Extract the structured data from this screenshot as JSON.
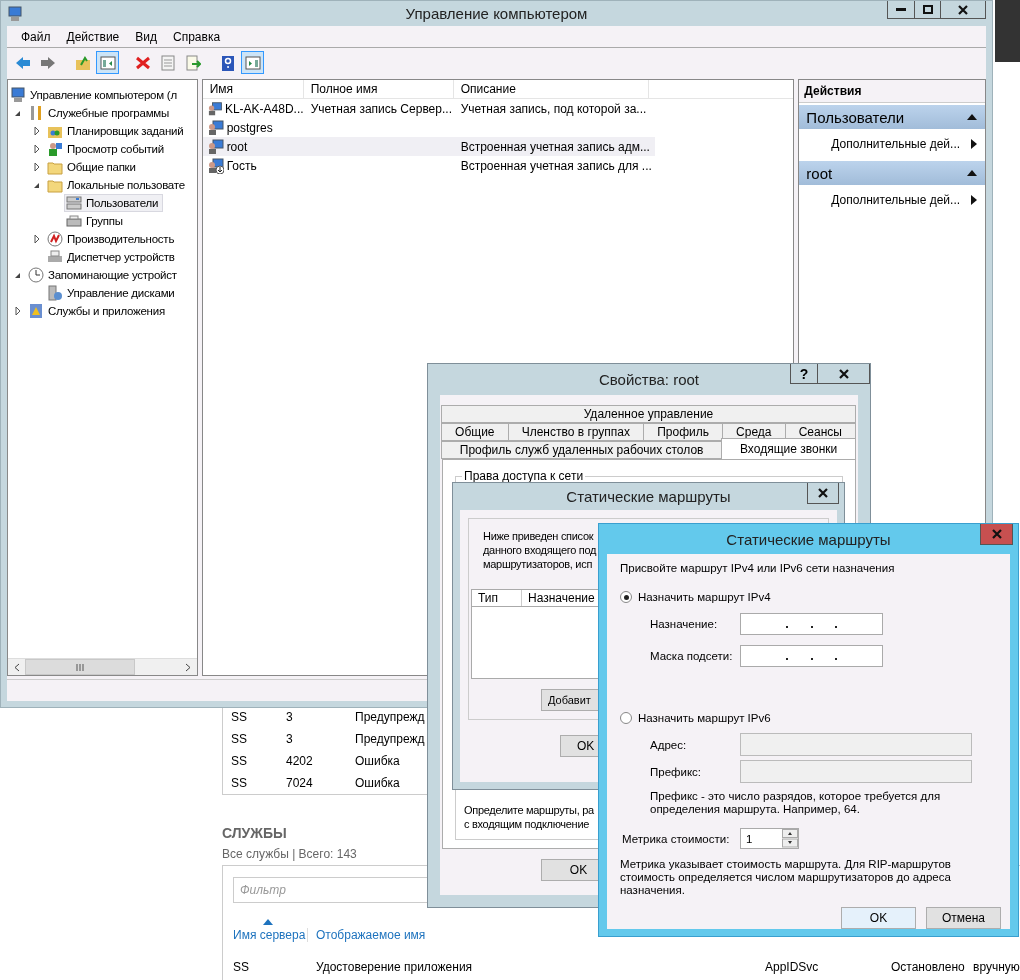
{
  "background": {
    "events": [
      {
        "server": "SS",
        "id": "3",
        "severity": "Предупрежд"
      },
      {
        "server": "SS",
        "id": "3",
        "severity": "Предупрежд"
      },
      {
        "server": "SS",
        "id": "4202",
        "severity": "Ошибка"
      },
      {
        "server": "SS",
        "id": "7024",
        "severity": "Ошибка"
      }
    ],
    "services": {
      "title": "СЛУЖБЫ",
      "subtitle": "Все службы | Всего: 143",
      "filter_placeholder": "Фильтр",
      "columns": [
        {
          "label": "Имя сервера",
          "sorted": true
        },
        {
          "label": "Отображаемое имя",
          "sorted": false
        }
      ],
      "rows": [
        {
          "server": "SS",
          "display_name": "Удостоверение приложения",
          "service_name": "AppIDSvc",
          "status": "Остановлено",
          "start_type": "вручную"
        }
      ]
    }
  },
  "main_window": {
    "title": "Управление компьютером",
    "menu": [
      "Файл",
      "Действие",
      "Вид",
      "Справка"
    ],
    "toolbar": [
      {
        "pressed": false
      },
      {
        "pressed": false
      },
      {
        "pressed": false
      },
      {
        "pressed": true
      },
      {
        "pressed": false
      },
      {
        "pressed": false
      },
      {
        "pressed": false
      },
      {
        "pressed": false
      },
      {
        "pressed": true
      }
    ],
    "tree": [
      {
        "label": "Управление компьютером (л",
        "selected": false,
        "children": [
          {
            "label": "Служебные программы",
            "selected": false,
            "expanded": true,
            "children": [
              {
                "label": "Планировщик заданий",
                "selected": false,
                "expanded": false
              },
              {
                "label": "Просмотр событий",
                "selected": false,
                "expanded": false
              },
              {
                "label": "Общие папки",
                "selected": false,
                "expanded": false
              },
              {
                "label": "Локальные пользовате",
                "selected": false,
                "expanded": true,
                "children": [
                  {
                    "label": "Пользователи",
                    "selected": true
                  },
                  {
                    "label": "Группы",
                    "selected": false
                  }
                ]
              },
              {
                "label": "Производительность",
                "selected": false,
                "expanded": false
              },
              {
                "label": "Диспетчер устройств",
                "selected": false
              }
            ]
          },
          {
            "label": "Запоминающие устройст",
            "selected": false,
            "expanded": true,
            "children": [
              {
                "label": "Управление дисками",
                "selected": false
              }
            ]
          },
          {
            "label": "Службы и приложения",
            "selected": false,
            "expanded": false
          }
        ]
      }
    ],
    "list": {
      "columns": [
        "Имя",
        "Полное имя",
        "Описание"
      ],
      "rows": [
        {
          "name": "KL-AK-A48D...",
          "full_name": "Учетная запись Сервер...",
          "description": "Учетная запись, под которой за...",
          "selected": false,
          "disabled": false
        },
        {
          "name": "postgres",
          "selected": false,
          "disabled": false
        },
        {
          "name": "root",
          "description": "Встроенная учетная запись адм...",
          "selected": true,
          "disabled": false
        },
        {
          "name": "Гость",
          "description": "Встроенная учетная запись для ...",
          "selected": false,
          "disabled": true
        }
      ]
    },
    "actions": {
      "title": "Действия",
      "sections": [
        {
          "title": "Пользователи",
          "items": [
            "Дополнительные дей..."
          ]
        },
        {
          "title": "root",
          "items": [
            "Дополнительные дей..."
          ]
        }
      ]
    }
  },
  "properties_dialog": {
    "title": "Свойства: root",
    "help_button": "?",
    "tab_rows": [
      [
        {
          "label": "Удаленное управление",
          "selected": false
        }
      ],
      [
        {
          "label": "Общие",
          "selected": false
        },
        {
          "label": "Членство в группах",
          "selected": false
        },
        {
          "label": "Профиль",
          "selected": false
        },
        {
          "label": "Среда",
          "selected": false
        },
        {
          "label": "Сеансы",
          "selected": false
        }
      ],
      [
        {
          "label": "Профиль служб удаленных рабочих столов",
          "selected": false
        },
        {
          "label": "Входящие звонки",
          "selected": true
        }
      ]
    ],
    "group_title": "Права доступа к сети",
    "note_lines": [
      "Определите маршруты, ра",
      "с  входящим подключение"
    ],
    "ok": "OK"
  },
  "routes_dialog": {
    "title": "Статические маршруты",
    "intro_lines": [
      "Ниже приведен список",
      "данного входящего под",
      "маршрутизаторов, исп"
    ],
    "columns": [
      "Тип",
      "Назначение"
    ],
    "add_button": "Добавит",
    "ok": "OK"
  },
  "route_editor": {
    "title": "Статические маршруты",
    "prompt": "Присвойте маршрут IPv4 или IPv6 сети назначения",
    "options": [
      {
        "label": "Назначить маршрут IPv4",
        "selected": true,
        "fields": [
          {
            "label": "Назначение:",
            "kind": "ip",
            "disabled": false
          },
          {
            "label": "Маска подсети:",
            "kind": "ip",
            "disabled": false
          }
        ]
      },
      {
        "label": "Назначить маршрут IPv6",
        "selected": false,
        "fields": [
          {
            "label": "Адрес:",
            "kind": "text",
            "disabled": true
          },
          {
            "label": "Префикс:",
            "kind": "text",
            "disabled": true
          }
        ],
        "hint": "Префикс - это число разрядов, которое требуется для определения маршрута. Например, 64."
      }
    ],
    "metric": {
      "label": "Метрика стоимости:",
      "value": "1"
    },
    "metric_hint": "Метрика указывает стоимость маршрута. Для RIP-маршрутов стоимость определяется числом маршрутизаторов до адреса назначения.",
    "buttons": [
      "OK",
      "Отмена"
    ]
  }
}
